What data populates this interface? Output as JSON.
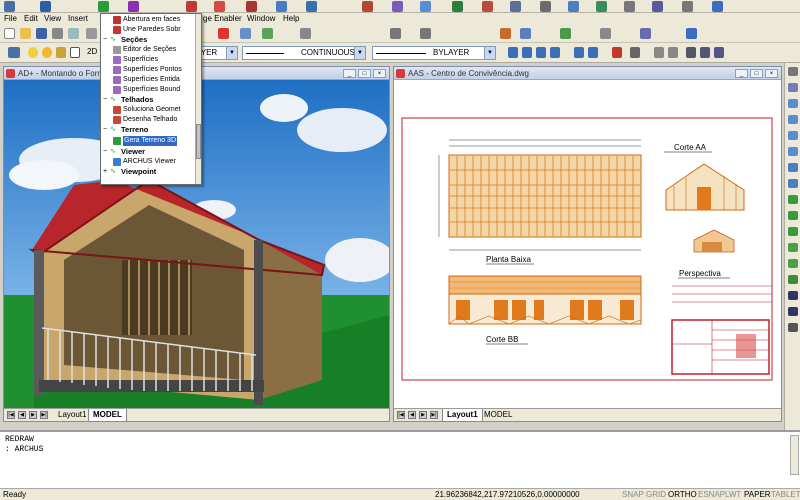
{
  "menubar": {
    "items": [
      "File",
      "Edit",
      "View",
      "Insert",
      "ge Enabler",
      "Window",
      "Help"
    ]
  },
  "toolbar": {
    "layer_combo": "AYER",
    "linetype_combo": "CONTINUOUS",
    "lineweight_combo": "BYLAYER",
    "model_label": "2D"
  },
  "dropdown_menu": {
    "items": [
      {
        "label": "Abertura em faces",
        "icon": "opening-icon",
        "group": false
      },
      {
        "label": "Une Paredes Sobr",
        "icon": "wall-icon",
        "group": false
      },
      {
        "label": "Seções",
        "icon": "",
        "group": true
      },
      {
        "label": "Editor de Seções",
        "icon": "section-editor-icon",
        "group": false
      },
      {
        "label": "Superfícies",
        "icon": "surface-icon",
        "group": false
      },
      {
        "label": "Superfícies Pontos",
        "icon": "surface-points-icon",
        "group": false
      },
      {
        "label": "Superfícies Entida",
        "icon": "surface-entity-icon",
        "group": false
      },
      {
        "label": "Superfícies Bound",
        "icon": "surface-boundary-icon",
        "group": false
      },
      {
        "label": "Telhados",
        "icon": "",
        "group": true
      },
      {
        "label": "Soluciona Geomet",
        "icon": "roof-solve-icon",
        "group": false
      },
      {
        "label": "Desenha Telhado",
        "icon": "roof-draw-icon",
        "group": false
      },
      {
        "label": "Terreno",
        "icon": "",
        "group": true
      },
      {
        "label": "Gera Terreno 3D",
        "icon": "terrain-icon",
        "group": false,
        "selected": true
      },
      {
        "label": "Viewer",
        "icon": "",
        "group": true
      },
      {
        "label": "ARCHUS Viewer",
        "icon": "viewer-icon",
        "group": false
      },
      {
        "label": "Viewpoint",
        "icon": "",
        "group": true
      }
    ]
  },
  "left_window": {
    "title": "AD+ - Montando o Forro",
    "tabs": [
      "Layout1",
      "MODEL"
    ],
    "active_tab": "MODEL"
  },
  "right_window": {
    "title": "AAS - Centro de Convivência.dwg",
    "tabs": [
      "Layout1",
      "MODEL"
    ],
    "active_tab": "Layout1",
    "drawing_labels": {
      "section_aa": "Corte AA",
      "plan": "Planta Baixa",
      "perspective": "Perspectiva",
      "section_bb": "Corte BB"
    }
  },
  "command_line": {
    "lines": [
      "REDRAW",
      ": ARCHUS"
    ]
  },
  "status_bar": {
    "ready": "Ready",
    "coords": "21.96236842,217.97210526,0.00000000",
    "toggles": [
      {
        "label": "SNAP",
        "on": false
      },
      {
        "label": "GRID",
        "on": false
      },
      {
        "label": "ORTHO",
        "on": true
      },
      {
        "label": "ESNAP",
        "on": false
      },
      {
        "label": "LWT",
        "on": false
      },
      {
        "label": "PAPER",
        "on": true
      },
      {
        "label": "TABLET",
        "on": false
      }
    ]
  },
  "colors": {
    "roof": "#b8252a",
    "wall": "#c9a66b",
    "sky": "#3a86d6",
    "grass": "#1f8f2f",
    "drawing_orange": "#e07a1a"
  }
}
